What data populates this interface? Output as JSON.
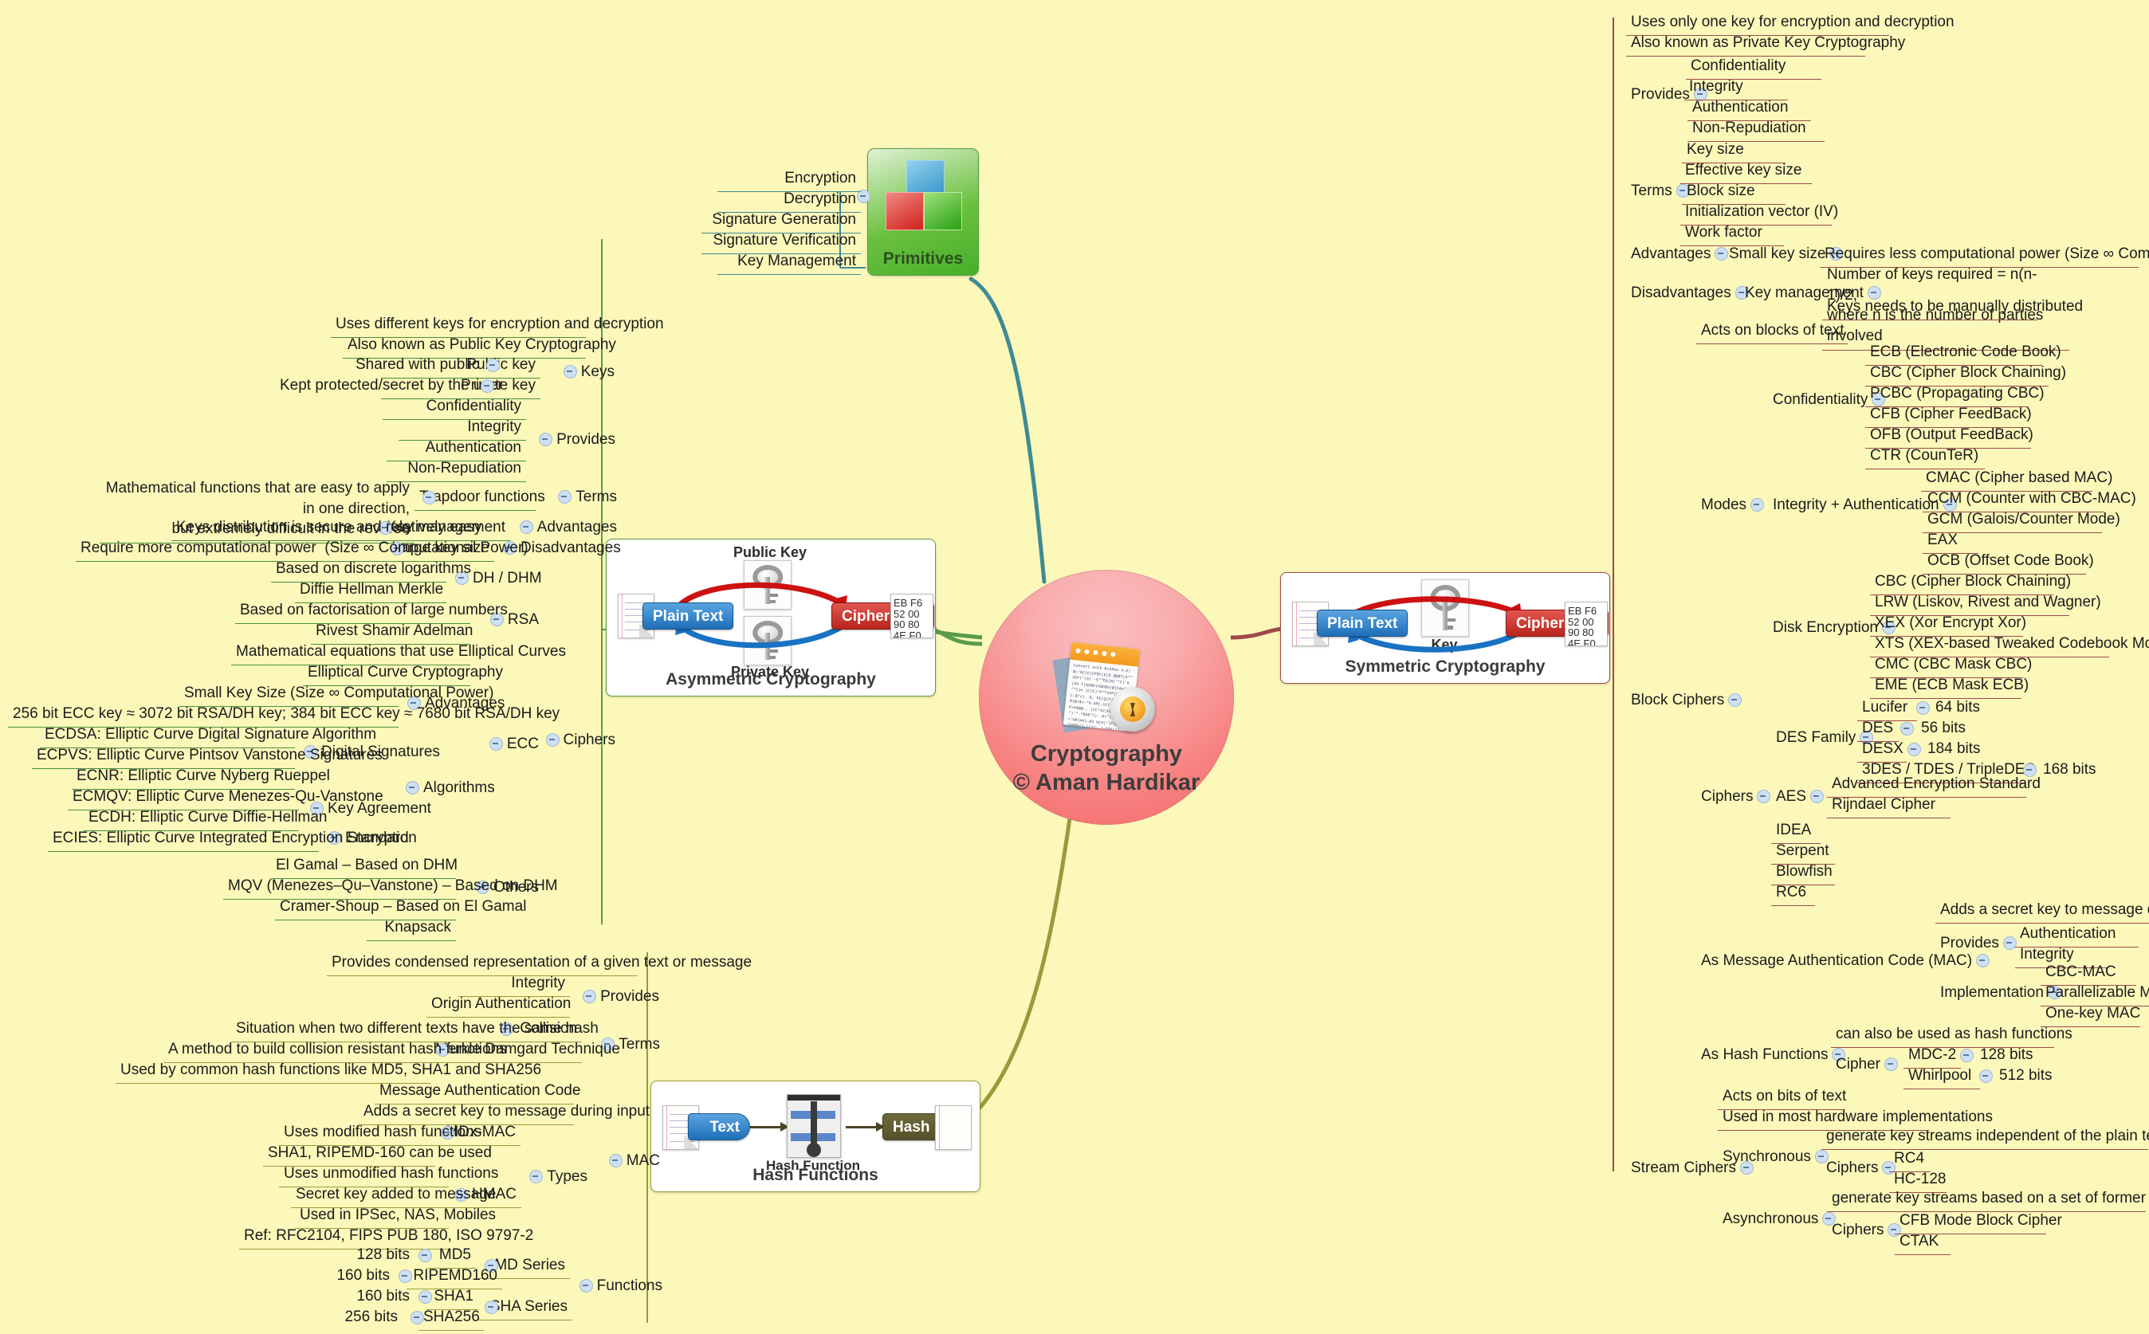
{
  "root": {
    "title_line1": "Cryptography",
    "title_line2": "© Aman Hardikar",
    "icon": "encrypted-document-lock-icon"
  },
  "cards": {
    "primitives": {
      "caption": "Primitives",
      "icon": "three-cubes-icon"
    },
    "asymmetric": {
      "caption": "Asymmetric Cryptography",
      "plain_text": "Plain Text",
      "cipher_text": "Cipher Text",
      "top_key": "Public Key",
      "bottom_key": "Private Key",
      "cipher_dump": "EB F6\n52 00\n90 80\n4E F0"
    },
    "symmetric": {
      "caption": "Symmetric Cryptography",
      "plain_text": "Plain Text",
      "cipher_text": "Cipher Text",
      "key_label": "Key",
      "cipher_dump": "EB F6\n52 00\n90 80\n4E F0"
    },
    "hash": {
      "caption": "Hash Functions",
      "text_label": "Text",
      "hash_label": "Hash",
      "function_label": "Hash Function"
    }
  },
  "connector_colors": {
    "primitives": "#3f8a94",
    "asymmetric": "#5a9c4a",
    "symmetric": "#9e4a4a",
    "hash": "#9a9a3c"
  },
  "primitives_children": [
    "Encryption",
    "Decryption",
    "Signature Generation",
    "Signature Verification",
    "Key Management"
  ],
  "asymmetric": {
    "notes": [
      "Uses different keys for encryption and decryption",
      "Also known as Public Key Cryptography"
    ],
    "keys": {
      "label": "Keys",
      "items": [
        {
          "label": "Public key",
          "note": "Shared with public"
        },
        {
          "label": "Private key",
          "note": "Kept protected/secret by the user"
        }
      ]
    },
    "provides": {
      "label": "Provides",
      "items": [
        "Confidentiality",
        "Integrity",
        "Authentication",
        "Non-Repudiation"
      ]
    },
    "terms": {
      "label": "Terms",
      "items": [
        {
          "label": "Trapdoor functions",
          "note": "Mathematical functions that are easy to apply in one direction,\nbut extremely difficult in the reverse"
        }
      ]
    },
    "advantages": {
      "label": "Advantages",
      "items": [
        {
          "label": "Key management",
          "note": "Keys distribution is secure and relatively easy"
        }
      ]
    },
    "disadvantages": {
      "label": "Disadvantages",
      "items": [
        {
          "label": "Large key size",
          "note": "Require more computational power  (Size ∞ Computational Power)"
        }
      ]
    },
    "ciphers": {
      "label": "Ciphers",
      "dh": {
        "label": "DH / DHM",
        "notes": [
          "Based on discrete logarithms",
          "Diffie Hellman Merkle"
        ]
      },
      "rsa": {
        "label": "RSA",
        "notes": [
          "Based on factorisation of large numbers",
          "Rivest Shamir Adelman"
        ]
      },
      "ecc": {
        "label": "ECC",
        "notes": [
          "Mathematical equations that use Elliptical Curves",
          "Elliptical Curve Cryptography"
        ],
        "advantages": {
          "label": "Advantages",
          "items": [
            "Small Key Size (Size ∞ Computational Power)",
            "256 bit ECC key ≈ 3072 bit RSA/DH key; 384 bit ECC key ≈ 7680 bit RSA/DH key"
          ]
        },
        "algorithms": {
          "label": "Algorithms",
          "digital_signatures": {
            "label": "Digital Signatures",
            "items": [
              "ECDSA: Elliptic Curve Digital Signature Algorithm",
              "ECPVS: Elliptic Curve Pintsov Vanstone Signatures",
              "ECNR: Elliptic Curve Nyberg Rueppel"
            ]
          },
          "key_agreement": {
            "label": "Key Agreement",
            "items": [
              "ECMQV: Elliptic Curve Menezes-Qu-Vanstone",
              "ECDH: Elliptic Curve Diffie-Hellman"
            ]
          },
          "encryption": {
            "label": "Encryption",
            "items": [
              "ECIES: Elliptic Curve Integrated Encryption Standard"
            ]
          }
        }
      },
      "others": {
        "label": "Others",
        "items": [
          "El Gamal – Based on DHM",
          "MQV (Menezes–Qu–Vanstone) – Based on DHM",
          "Cramer-Shoup – Based on El Gamal",
          "Knapsack"
        ]
      }
    }
  },
  "hash_functions": {
    "note": "Provides condensed representation of a given text or message",
    "provides": {
      "label": "Provides",
      "items": [
        "Integrity",
        "Origin Authentication"
      ]
    },
    "terms": {
      "label": "Terms",
      "items": [
        {
          "label": "Collision",
          "notes": [
            "Situation when two different texts have the same hash"
          ]
        },
        {
          "label": "Merkle Damgard Technique",
          "notes": [
            "A method to build collision resistant hash functions",
            "Used by common hash functions like MD5, SHA1 and SHA256"
          ]
        }
      ]
    },
    "mac": {
      "label": "MAC",
      "notes": [
        "Message Authentication Code",
        "Adds a secret key to message during input"
      ],
      "types": {
        "label": "Types",
        "items": [
          {
            "label": "MDx-MAC",
            "notes": [
              "Uses modified hash functions",
              "SHA1, RIPEMD-160 can be used"
            ]
          },
          {
            "label": "HMAC",
            "notes": [
              "Uses unmodified hash functions",
              "Secret key added to message",
              "Used in IPSec, NAS, Mobiles",
              "Ref: RFC2104, FIPS PUB 180, ISO 9797-2"
            ]
          }
        ]
      }
    },
    "functions": {
      "label": "Functions",
      "series": [
        {
          "label": "MD Series",
          "items": [
            {
              "name": "MD5",
              "bits": "128 bits"
            },
            {
              "name": "RIPEMD160",
              "bits": "160 bits"
            }
          ]
        },
        {
          "label": "SHA Series",
          "items": [
            {
              "name": "SHA1",
              "bits": "160 bits"
            },
            {
              "name": "SHA256",
              "bits": "256 bits"
            }
          ]
        }
      ]
    }
  },
  "symmetric": {
    "notes": [
      "Uses only one key for encryption and decryption",
      "Also known as Private Key Cryptography"
    ],
    "provides": {
      "label": "Provides",
      "items": [
        "Confidentiality",
        "Integrity",
        "Authentication",
        "Non-Repudiation"
      ]
    },
    "terms": {
      "label": "Terms",
      "items": [
        "Key size",
        "Effective key size",
        "Block size",
        "Initialization vector (IV)",
        "Work factor"
      ]
    },
    "advantages": {
      "label": "Advantages",
      "items": [
        {
          "label": "Small key size",
          "note": "Requires less computational power (Size ∞ Computational Power)"
        }
      ]
    },
    "disadvantages": {
      "label": "Disadvantages",
      "items": [
        {
          "label": "Key management",
          "notes": [
            "Number of keys required = n(n-1)/2,\nwhere n is the number of parties involved",
            "Keys needs to be manually distributed"
          ]
        }
      ]
    },
    "block_ciphers": {
      "label": "Block Ciphers",
      "note": "Acts on blocks of text",
      "modes": {
        "label": "Modes",
        "groups": [
          {
            "label": "Confidentiality",
            "items": [
              "ECB (Electronic Code Book)",
              "CBC (Cipher Block Chaining)",
              "PCBC (Propagating CBC)",
              "CFB (Cipher FeedBack)",
              "OFB (Output FeedBack)",
              "CTR (CounTeR)"
            ]
          },
          {
            "label": "Integrity + Authentication",
            "items": [
              "CMAC (Cipher based MAC)",
              "CCM (Counter with CBC-MAC)",
              "GCM (Galois/Counter Mode)",
              "EAX",
              "OCB (Offset Code Book)"
            ]
          },
          {
            "label": "Disk Encryption",
            "items": [
              "CBC (Cipher Block Chaining)",
              "LRW (Liskov, Rivest and Wagner)",
              "XEX (Xor Encrypt Xor)",
              "XTS (XEX-based Tweaked Codebook Mode)",
              "CMC (CBC Mask CBC)",
              "EME (ECB Mask ECB)"
            ]
          }
        ]
      },
      "ciphers": {
        "label": "Ciphers",
        "des_family": {
          "label": "DES Family",
          "items": [
            {
              "name": "Lucifer",
              "bits": "64 bits"
            },
            {
              "name": "DES",
              "bits": "56 bits"
            },
            {
              "name": "DESX",
              "bits": "184 bits"
            },
            {
              "name": "3DES / TDES / TripleDES",
              "bits": "168 bits"
            }
          ]
        },
        "aes": {
          "label": "AES",
          "items": [
            "Advanced Encryption Standard",
            "Rijndael Cipher"
          ]
        },
        "others": [
          "IDEA",
          "Serpent",
          "Blowfish",
          "RC6"
        ]
      },
      "as_mac": {
        "label": "As Message Authentication Code (MAC)",
        "note": "Adds a secret key to message during input",
        "provides": {
          "label": "Provides",
          "items": [
            "Authentication",
            "Integrity"
          ]
        },
        "implementation": {
          "label": "Implementation",
          "items": [
            "CBC-MAC",
            "Parallelizable MAC",
            "One-key MAC"
          ]
        }
      },
      "as_hash": {
        "label": "As Hash Functions",
        "note": "can also be used as hash functions",
        "cipher": {
          "label": "Cipher",
          "items": [
            {
              "name": "MDC-2",
              "bits": "128 bits"
            },
            {
              "name": "Whirlpool",
              "bits": "512 bits"
            }
          ]
        }
      }
    },
    "stream_ciphers": {
      "label": "Stream Ciphers",
      "notes": [
        "Acts on bits of text",
        "Used in most hardware implementations"
      ],
      "synchronous": {
        "label": "Synchronous",
        "note": "generate key streams independent of the plain text and cipher text",
        "ciphers": {
          "label": "Ciphers",
          "items": [
            "RC4",
            "HC-128"
          ]
        }
      },
      "asynchronous": {
        "label": "Asynchronous",
        "note": "generate key streams based on a set of former cipher text bits",
        "ciphers": {
          "label": "Ciphers",
          "items": [
            "CFB Mode Block Cipher",
            "CTAK"
          ]
        }
      }
    }
  }
}
